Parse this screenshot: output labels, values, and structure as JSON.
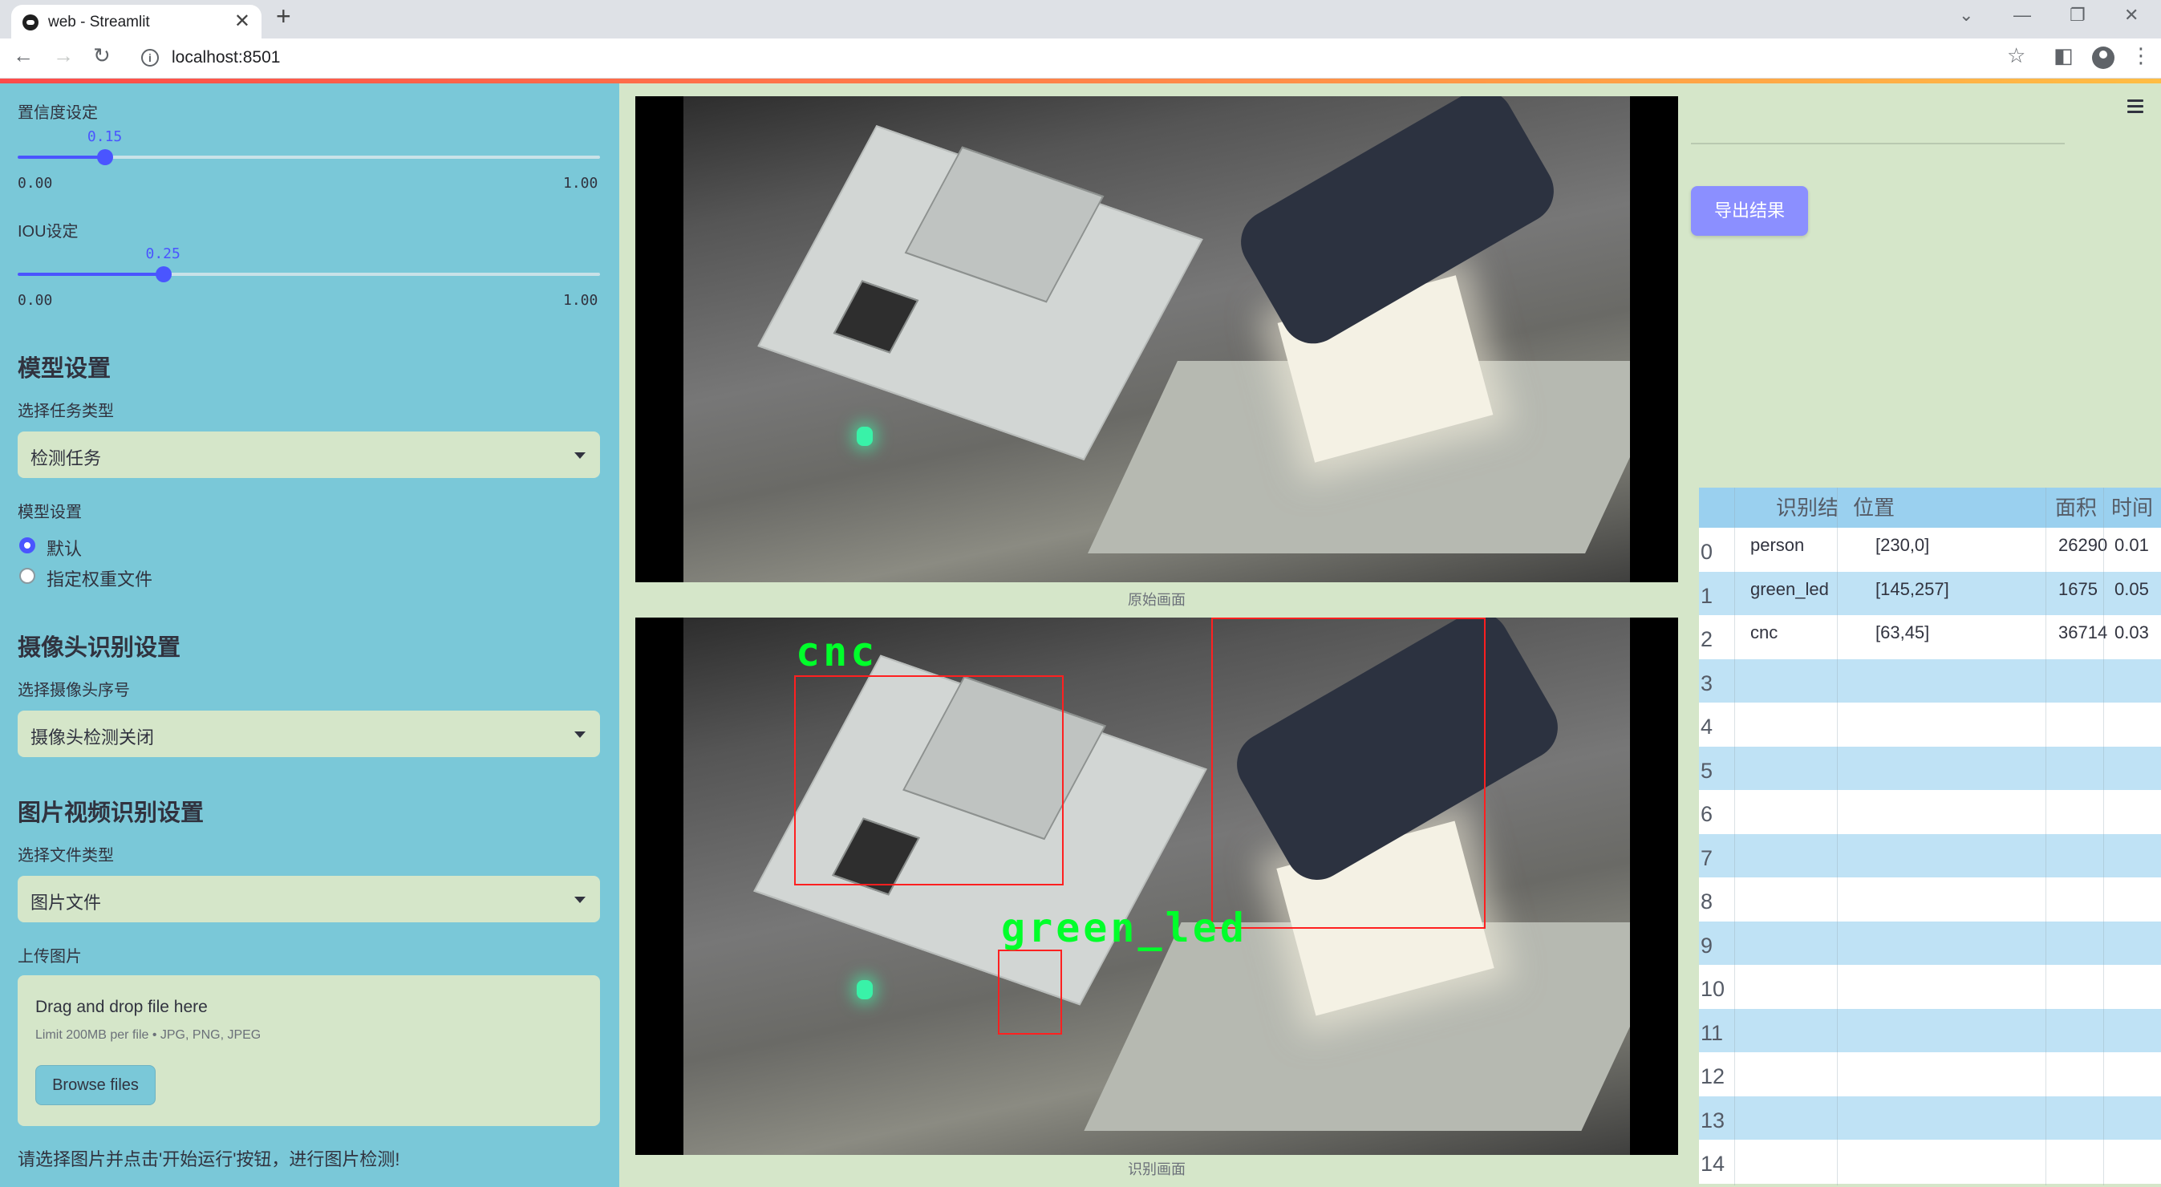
{
  "browser": {
    "tab_title": "web - Streamlit",
    "tab_close": "✕",
    "new_tab": "+",
    "url": "localhost:8501",
    "window_controls": [
      "⌄",
      "—",
      "❐",
      "✕"
    ]
  },
  "sidebar": {
    "confidence": {
      "label": "置信度设定",
      "value": "0.15",
      "fraction": 0.15,
      "min": "0.00",
      "max": "1.00"
    },
    "iou": {
      "label": "IOU设定",
      "value": "0.25",
      "fraction": 0.25,
      "min": "0.00",
      "max": "1.00"
    },
    "model_heading": "模型设置",
    "task_type_label": "选择任务类型",
    "task_type_value": "检测任务",
    "model_setting_label": "模型设置",
    "model_options": [
      {
        "label": "默认",
        "checked": true
      },
      {
        "label": "指定权重文件",
        "checked": false
      }
    ],
    "camera_heading": "摄像头识别设置",
    "camera_label": "选择摄像头序号",
    "camera_value": "摄像头检测关闭",
    "media_heading": "图片视频识别设置",
    "file_type_label": "选择文件类型",
    "file_type_value": "图片文件",
    "upload_label": "上传图片",
    "upload_title": "Drag and drop file here",
    "upload_limit": "Limit 200MB per file • JPG, PNG, JPEG",
    "browse_label": "Browse files",
    "footer_text": "请选择图片并点击'开始运行'按钮，进行图片检测!"
  },
  "main": {
    "original_caption": "原始画面",
    "result_caption": "识别画面",
    "detections": [
      {
        "label": "cnc"
      },
      {
        "label": "green_led"
      },
      {
        "label": ""
      }
    ]
  },
  "right": {
    "export_label": "导出结果",
    "table": {
      "headers": [
        "",
        "识别结果",
        "位置",
        "面积",
        "时间"
      ],
      "rows": [
        [
          "0",
          "person",
          "[230,0]",
          "26290",
          "0.01"
        ],
        [
          "1",
          "green_led",
          "[145,257]",
          "1675",
          "0.05"
        ],
        [
          "2",
          "cnc",
          "[63,45]",
          "36714",
          "0.03"
        ],
        [
          "3",
          "",
          "",
          "",
          ""
        ],
        [
          "4",
          "",
          "",
          "",
          ""
        ],
        [
          "5",
          "",
          "",
          "",
          ""
        ],
        [
          "6",
          "",
          "",
          "",
          ""
        ],
        [
          "7",
          "",
          "",
          "",
          ""
        ],
        [
          "8",
          "",
          "",
          "",
          ""
        ],
        [
          "9",
          "",
          "",
          "",
          ""
        ],
        [
          "10",
          "",
          "",
          "",
          ""
        ],
        [
          "11",
          "",
          "",
          "",
          ""
        ],
        [
          "12",
          "",
          "",
          "",
          ""
        ],
        [
          "13",
          "",
          "",
          "",
          ""
        ],
        [
          "14",
          "",
          "",
          "",
          ""
        ]
      ]
    }
  },
  "colors": {
    "sidebar_bg": "#7ac8d8",
    "main_bg": "#d5e6c9",
    "accent": "#4a55ff",
    "export_button": "#8b8fff",
    "box_color": "#ff2020",
    "label_color": "#00ff2a"
  }
}
